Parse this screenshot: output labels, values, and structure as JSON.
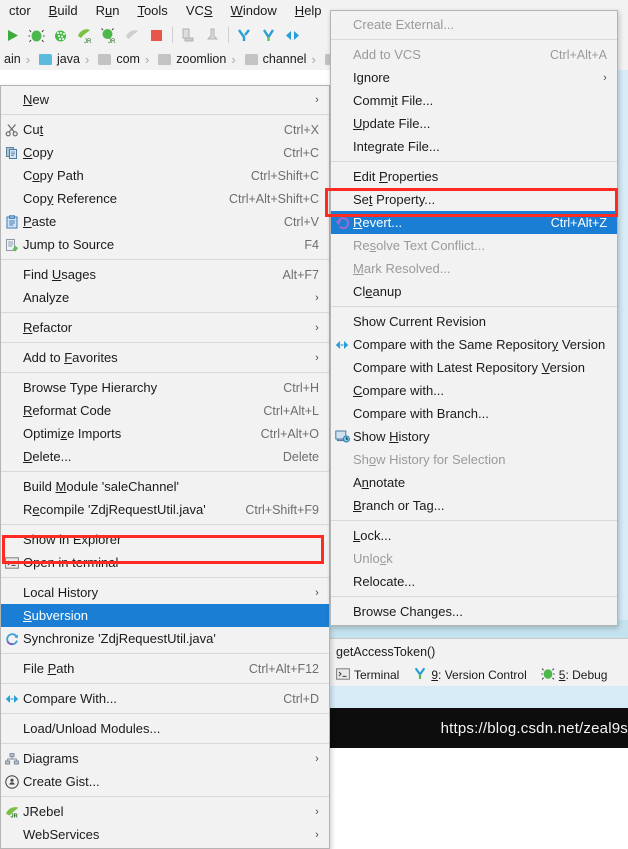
{
  "app": {
    "menubar": [
      {
        "label": "ctor",
        "mnemonic": ""
      },
      {
        "label": "Build",
        "mnemonic": "B"
      },
      {
        "label": "Run",
        "mnemonic": "u"
      },
      {
        "label": "Tools",
        "mnemonic": "T"
      },
      {
        "label": "VCS",
        "mnemonic": "S"
      },
      {
        "label": "Window",
        "mnemonic": "W"
      },
      {
        "label": "Help",
        "mnemonic": "H"
      }
    ],
    "toolbar_icons": [
      "run-icon",
      "debug-icon",
      "coverage-icon",
      "jrebel-run-icon",
      "jrebel-debug-icon",
      "profile-icon",
      "stop-icon",
      "build-project-icon",
      "build-module-icon",
      "update-project-icon",
      "commit-icon",
      "compare-icon"
    ],
    "breadcrumbs": [
      {
        "label": "ain",
        "icon": "folder-icon",
        "color": "grey"
      },
      {
        "label": "java",
        "icon": "folder-icon",
        "color": "blue"
      },
      {
        "label": "com",
        "icon": "folder-icon",
        "color": "grey"
      },
      {
        "label": "zoomlion",
        "icon": "folder-icon",
        "color": "grey"
      },
      {
        "label": "channel",
        "icon": "folder-icon",
        "color": "grey"
      }
    ]
  },
  "context_menu": {
    "groups": [
      {
        "items": [
          {
            "label": "New",
            "mnemonic": "N",
            "icon": null,
            "shortcut": "",
            "submenu": true,
            "disabled": false,
            "selected": false
          }
        ]
      },
      {
        "items": [
          {
            "label": "Cut",
            "mnemonic": "t",
            "icon": "scissors-icon",
            "shortcut": "Ctrl+X",
            "submenu": false,
            "disabled": false,
            "selected": false
          },
          {
            "label": "Copy",
            "mnemonic": "C",
            "icon": "copy-icon",
            "shortcut": "Ctrl+C",
            "submenu": false,
            "disabled": false,
            "selected": false
          },
          {
            "label": "Copy Path",
            "mnemonic": "o",
            "icon": null,
            "shortcut": "Ctrl+Shift+C",
            "submenu": false,
            "disabled": false,
            "selected": false
          },
          {
            "label": "Copy Reference",
            "mnemonic": "y",
            "icon": null,
            "shortcut": "Ctrl+Alt+Shift+C",
            "submenu": false,
            "disabled": false,
            "selected": false
          },
          {
            "label": "Paste",
            "mnemonic": "P",
            "icon": "paste-icon",
            "shortcut": "Ctrl+V",
            "submenu": false,
            "disabled": false,
            "selected": false
          },
          {
            "label": "Jump to Source",
            "mnemonic": "",
            "icon": "jump-to-source-icon",
            "shortcut": "F4",
            "submenu": false,
            "disabled": false,
            "selected": false
          }
        ]
      },
      {
        "items": [
          {
            "label": "Find Usages",
            "mnemonic": "U",
            "icon": null,
            "shortcut": "Alt+F7",
            "submenu": false,
            "disabled": false,
            "selected": false
          },
          {
            "label": "Analyze",
            "mnemonic": "",
            "icon": null,
            "shortcut": "",
            "submenu": true,
            "disabled": false,
            "selected": false
          }
        ]
      },
      {
        "items": [
          {
            "label": "Refactor",
            "mnemonic": "R",
            "icon": null,
            "shortcut": "",
            "submenu": true,
            "disabled": false,
            "selected": false
          }
        ]
      },
      {
        "items": [
          {
            "label": "Add to Favorites",
            "mnemonic": "F",
            "icon": null,
            "shortcut": "",
            "submenu": true,
            "disabled": false,
            "selected": false
          }
        ]
      },
      {
        "items": [
          {
            "label": "Browse Type Hierarchy",
            "mnemonic": "",
            "icon": null,
            "shortcut": "Ctrl+H",
            "submenu": false,
            "disabled": false,
            "selected": false
          },
          {
            "label": "Reformat Code",
            "mnemonic": "R",
            "icon": null,
            "shortcut": "Ctrl+Alt+L",
            "submenu": false,
            "disabled": false,
            "selected": false
          },
          {
            "label": "Optimize Imports",
            "mnemonic": "z",
            "icon": null,
            "shortcut": "Ctrl+Alt+O",
            "submenu": false,
            "disabled": false,
            "selected": false
          },
          {
            "label": "Delete...",
            "mnemonic": "D",
            "icon": null,
            "shortcut": "Delete",
            "submenu": false,
            "disabled": false,
            "selected": false
          }
        ]
      },
      {
        "items": [
          {
            "label": "Build Module 'saleChannel'",
            "mnemonic": "M",
            "icon": null,
            "shortcut": "",
            "submenu": false,
            "disabled": false,
            "selected": false
          },
          {
            "label": "Recompile 'ZdjRequestUtil.java'",
            "mnemonic": "e",
            "icon": null,
            "shortcut": "Ctrl+Shift+F9",
            "submenu": false,
            "disabled": false,
            "selected": false
          }
        ]
      },
      {
        "items": [
          {
            "label": "Show in Explorer",
            "mnemonic": "",
            "icon": null,
            "shortcut": "",
            "submenu": false,
            "disabled": false,
            "selected": false
          },
          {
            "label": "Open in terminal",
            "mnemonic": "",
            "icon": "terminal-icon",
            "shortcut": "",
            "submenu": false,
            "disabled": false,
            "selected": false
          }
        ]
      },
      {
        "items": [
          {
            "label": "Local History",
            "mnemonic": "",
            "icon": null,
            "shortcut": "",
            "submenu": true,
            "disabled": false,
            "selected": false
          },
          {
            "label": "Subversion",
            "mnemonic": "S",
            "icon": null,
            "shortcut": "",
            "submenu": false,
            "disabled": false,
            "selected": true
          },
          {
            "label": "Synchronize 'ZdjRequestUtil.java'",
            "mnemonic": "",
            "icon": "synchronize-icon",
            "shortcut": "",
            "submenu": false,
            "disabled": false,
            "selected": false
          }
        ]
      },
      {
        "items": [
          {
            "label": "File Path",
            "mnemonic": "P",
            "icon": null,
            "shortcut": "Ctrl+Alt+F12",
            "submenu": false,
            "disabled": false,
            "selected": false
          }
        ]
      },
      {
        "items": [
          {
            "label": "Compare With...",
            "mnemonic": "",
            "icon": "compare-icon",
            "shortcut": "Ctrl+D",
            "submenu": false,
            "disabled": false,
            "selected": false
          }
        ]
      },
      {
        "items": [
          {
            "label": "Load/Unload Modules...",
            "mnemonic": "",
            "icon": null,
            "shortcut": "",
            "submenu": false,
            "disabled": false,
            "selected": false
          }
        ]
      },
      {
        "items": [
          {
            "label": "Diagrams",
            "mnemonic": "",
            "icon": "diagram-icon",
            "shortcut": "",
            "submenu": true,
            "disabled": false,
            "selected": false
          },
          {
            "label": "Create Gist...",
            "mnemonic": "",
            "icon": "gist-icon",
            "shortcut": "",
            "submenu": false,
            "disabled": false,
            "selected": false
          }
        ]
      },
      {
        "items": [
          {
            "label": "JRebel",
            "mnemonic": "",
            "icon": "jrebel-icon",
            "shortcut": "",
            "submenu": true,
            "disabled": false,
            "selected": false
          },
          {
            "label": "WebServices",
            "mnemonic": "",
            "icon": null,
            "shortcut": "",
            "submenu": true,
            "disabled": false,
            "selected": false
          }
        ]
      }
    ]
  },
  "submenu": {
    "groups": [
      {
        "items": [
          {
            "label": "Create External...",
            "mnemonic": "",
            "icon": null,
            "shortcut": "",
            "submenu": false,
            "disabled": true,
            "selected": false
          }
        ]
      },
      {
        "items": [
          {
            "label": "Add to VCS",
            "mnemonic": "",
            "icon": null,
            "shortcut": "Ctrl+Alt+A",
            "submenu": false,
            "disabled": true,
            "selected": false
          },
          {
            "label": "Ignore",
            "mnemonic": "",
            "icon": null,
            "shortcut": "",
            "submenu": true,
            "disabled": false,
            "selected": false
          },
          {
            "label": "Commit File...",
            "mnemonic": "i",
            "icon": null,
            "shortcut": "",
            "submenu": false,
            "disabled": false,
            "selected": false
          },
          {
            "label": "Update File...",
            "mnemonic": "U",
            "icon": null,
            "shortcut": "",
            "submenu": false,
            "disabled": false,
            "selected": false
          },
          {
            "label": "Integrate File...",
            "mnemonic": "g",
            "icon": null,
            "shortcut": "",
            "submenu": false,
            "disabled": false,
            "selected": false
          }
        ]
      },
      {
        "items": [
          {
            "label": "Edit Properties",
            "mnemonic": "P",
            "icon": null,
            "shortcut": "",
            "submenu": false,
            "disabled": false,
            "selected": false
          },
          {
            "label": "Set Property...",
            "mnemonic": "t",
            "icon": null,
            "shortcut": "",
            "submenu": false,
            "disabled": false,
            "selected": false
          },
          {
            "label": "Revert...",
            "mnemonic": "R",
            "icon": "revert-icon",
            "shortcut": "Ctrl+Alt+Z",
            "submenu": false,
            "disabled": false,
            "selected": true
          },
          {
            "label": "Resolve Text Conflict...",
            "mnemonic": "s",
            "icon": null,
            "shortcut": "",
            "submenu": false,
            "disabled": true,
            "selected": false
          },
          {
            "label": "Mark Resolved...",
            "mnemonic": "M",
            "icon": null,
            "shortcut": "",
            "submenu": false,
            "disabled": true,
            "selected": false
          },
          {
            "label": "Cleanup",
            "mnemonic": "e",
            "icon": null,
            "shortcut": "",
            "submenu": false,
            "disabled": false,
            "selected": false
          }
        ]
      },
      {
        "items": [
          {
            "label": "Show Current Revision",
            "mnemonic": "",
            "icon": null,
            "shortcut": "",
            "submenu": false,
            "disabled": false,
            "selected": false
          },
          {
            "label": "Compare with the Same Repository Version",
            "mnemonic": "y",
            "icon": "compare-icon",
            "shortcut": "",
            "submenu": false,
            "disabled": false,
            "selected": false
          },
          {
            "label": "Compare with Latest Repository Version",
            "mnemonic": "V",
            "icon": null,
            "shortcut": "",
            "submenu": false,
            "disabled": false,
            "selected": false
          },
          {
            "label": "Compare with...",
            "mnemonic": "C",
            "icon": null,
            "shortcut": "",
            "submenu": false,
            "disabled": false,
            "selected": false
          },
          {
            "label": "Compare with Branch...",
            "mnemonic": "",
            "icon": null,
            "shortcut": "",
            "submenu": false,
            "disabled": false,
            "selected": false
          },
          {
            "label": "Show History",
            "mnemonic": "H",
            "icon": "show-history-icon",
            "shortcut": "",
            "submenu": false,
            "disabled": false,
            "selected": false
          },
          {
            "label": "Show History for Selection",
            "mnemonic": "o",
            "icon": null,
            "shortcut": "",
            "submenu": false,
            "disabled": true,
            "selected": false
          },
          {
            "label": "Annotate",
            "mnemonic": "n",
            "icon": null,
            "shortcut": "",
            "submenu": false,
            "disabled": false,
            "selected": false
          },
          {
            "label": "Branch or Tag...",
            "mnemonic": "B",
            "icon": null,
            "shortcut": "",
            "submenu": false,
            "disabled": false,
            "selected": false
          }
        ]
      },
      {
        "items": [
          {
            "label": "Lock...",
            "mnemonic": "L",
            "icon": null,
            "shortcut": "",
            "submenu": false,
            "disabled": false,
            "selected": false
          },
          {
            "label": "Unlock",
            "mnemonic": "c",
            "icon": null,
            "shortcut": "",
            "submenu": false,
            "disabled": true,
            "selected": false
          },
          {
            "label": "Relocate...",
            "mnemonic": "",
            "icon": null,
            "shortcut": "",
            "submenu": false,
            "disabled": false,
            "selected": false
          }
        ]
      },
      {
        "items": [
          {
            "label": "Browse Changes...",
            "mnemonic": "",
            "icon": null,
            "shortcut": "",
            "submenu": false,
            "disabled": false,
            "selected": false
          }
        ]
      }
    ]
  },
  "status": {
    "breadcrumb_method": "getAccessToken()",
    "tool_windows": [
      {
        "label": "Terminal",
        "number": "",
        "icon": "terminal-icon"
      },
      {
        "label": ": Version Control",
        "number": "9",
        "icon": "version-control-icon"
      },
      {
        "label": ": Debug",
        "number": "5",
        "icon": "debug-icon"
      }
    ]
  },
  "watermark": {
    "url": "https://blog.csdn.net/zeal9s"
  },
  "colors": {
    "selection_blue": "#1a7fd4",
    "annotation_red": "#ff2a21",
    "menu_bg": "#f2f2f2",
    "editor_selection": "#d6ebf5"
  }
}
